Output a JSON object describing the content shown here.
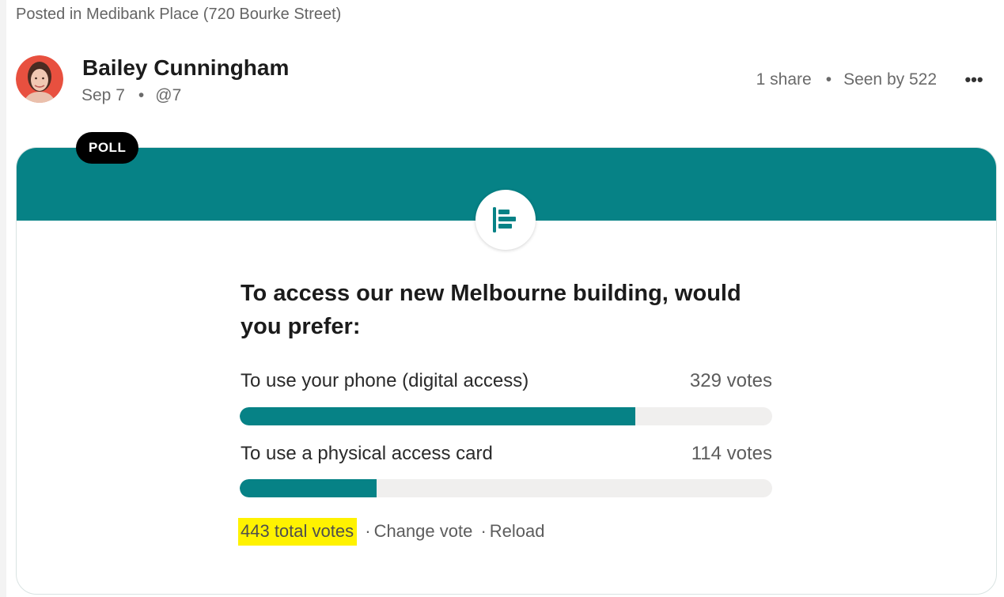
{
  "post": {
    "posted_in": "Posted in Medibank Place (720 Bourke Street)",
    "author": "Bailey Cunningham",
    "date": "Sep 7",
    "meta_dot": "•",
    "mention": "@7",
    "shares": "1 share",
    "stats_dot": "•",
    "seen_by": "Seen by 522",
    "more_label": "•••"
  },
  "poll": {
    "badge": "POLL",
    "question": "To access our new Melbourne building, would you prefer:",
    "options": [
      {
        "label": "To use your phone (digital access)",
        "votes": "329 votes",
        "fraction": 0.743
      },
      {
        "label": "To use a physical access card",
        "votes": "114 votes",
        "fraction": 0.257
      }
    ],
    "total_votes": "443 total votes",
    "separator": "·",
    "change_vote": "Change vote",
    "reload": "Reload",
    "accent_color": "#068286",
    "highlight_color": "#fff200"
  }
}
